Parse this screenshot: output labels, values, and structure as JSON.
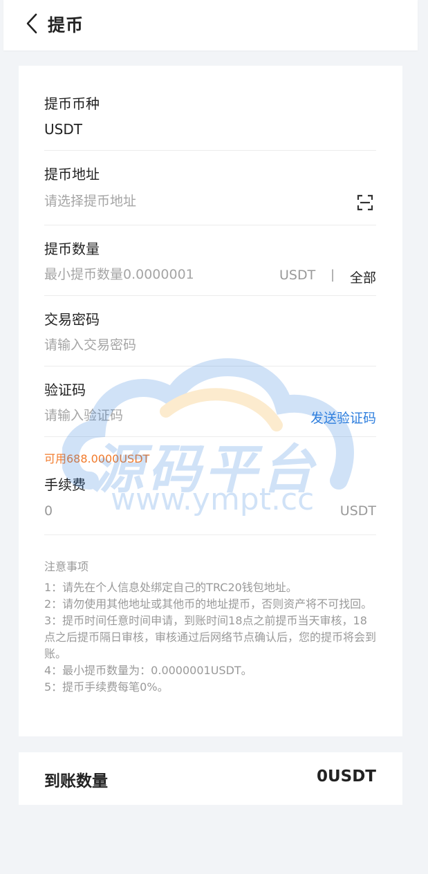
{
  "header": {
    "title": "提币"
  },
  "form": {
    "coin": {
      "label": "提币币种",
      "value": "USDT"
    },
    "address": {
      "label": "提币地址",
      "placeholder": "请选择提币地址"
    },
    "amount": {
      "label": "提币数量",
      "placeholder": "最小提币数量0.0000001",
      "unit": "USDT",
      "divider": "|",
      "all_label": "全部"
    },
    "password": {
      "label": "交易密码",
      "placeholder": "请输入交易密码"
    },
    "code": {
      "label": "验证码",
      "placeholder": "请输入验证码",
      "send_label": "发送验证码"
    },
    "available": "可用688.0000USDT",
    "fee": {
      "label": "手续费",
      "value": "0",
      "unit": "USDT"
    }
  },
  "notes": {
    "title": "注意事项",
    "items": [
      "1：请先在个人信息处绑定自己的TRC20钱包地址。",
      "2：请勿使用其他地址或其他币的地址提币，否则资产将不可找回。",
      "3：提币时间任意时间申请，到账时间18点之前提币当天审核，18点之后提币隔日审核，审核通过后网络节点确认后，您的提币将会到账。",
      "4：最小提币数量为：0.0000001USDT。",
      "5：提币手续费每笔0%。"
    ]
  },
  "summary": {
    "label": "到账数量",
    "value": "0USDT"
  },
  "watermark": {
    "text": "源码平台",
    "url": "www.ympt.cc"
  },
  "colors": {
    "accent": "#2f7fde",
    "warning": "#f27a2a",
    "background": "#f2f4f7"
  },
  "icons": {
    "back": "chevron-left-icon",
    "scan": "scan-icon"
  }
}
